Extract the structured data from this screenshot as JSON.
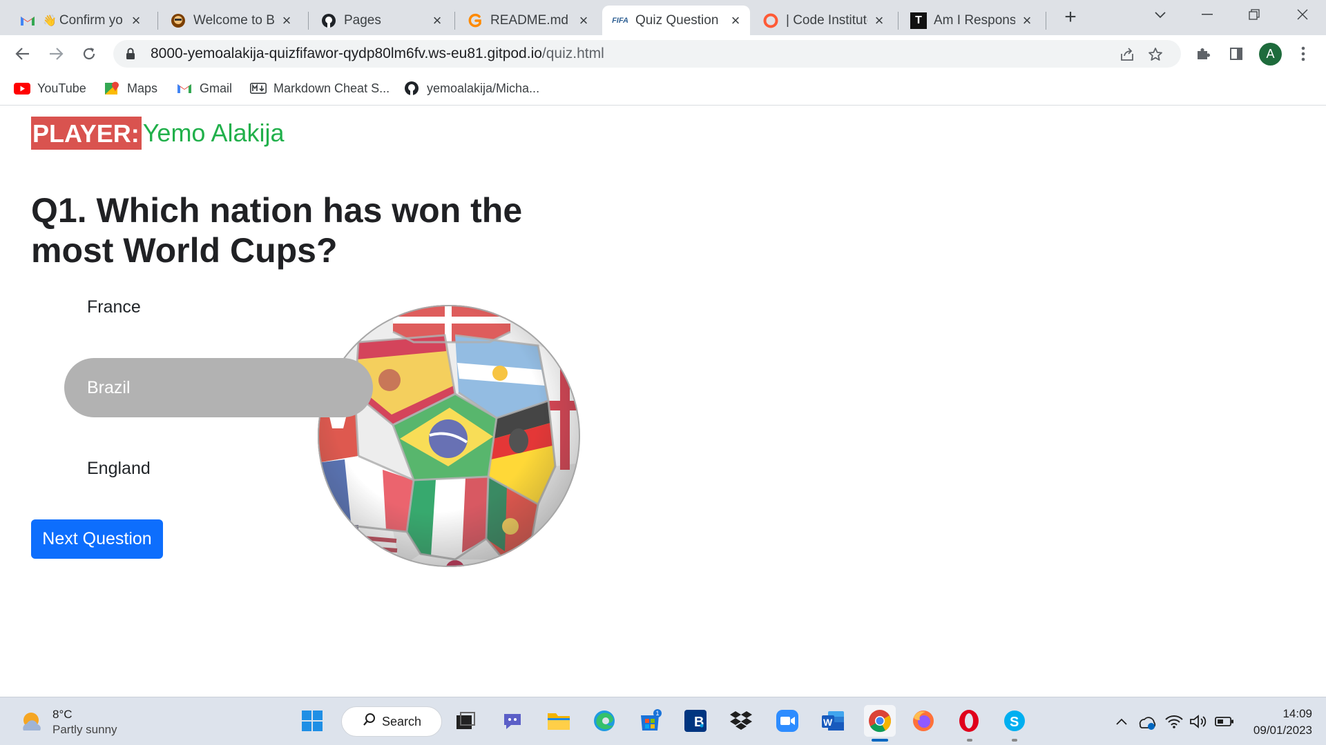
{
  "browser": {
    "tabs": [
      {
        "title": "Confirm yo",
        "favicon": "gmail-icon"
      },
      {
        "title": "Welcome to By",
        "favicon": "bytes-icon"
      },
      {
        "title": "Pages",
        "favicon": "github-icon"
      },
      {
        "title": "README.md - ",
        "favicon": "gitpod-icon"
      },
      {
        "title": "Quiz Question",
        "favicon": "fifa-icon",
        "favicon_text": "FIFA"
      },
      {
        "title": "| Code Institute",
        "favicon": "code-institute-icon"
      },
      {
        "title": "Am I Responsiv",
        "favicon": "amiresponsive-icon",
        "favicon_text": "T"
      }
    ],
    "active_tab": 4,
    "url_host": "8000-yemoalakija-quizfifawor-qydp80lm6fv.ws-eu81.gitpod.io",
    "url_path": "/quiz.html",
    "profile_initial": "A",
    "bookmarks": [
      {
        "label": "YouTube",
        "icon": "youtube-icon"
      },
      {
        "label": "Maps",
        "icon": "maps-icon"
      },
      {
        "label": "Gmail",
        "icon": "gmail-icon"
      },
      {
        "label": "Markdown Cheat S...",
        "icon": "markdown-icon"
      },
      {
        "label": "yemoalakija/Micha...",
        "icon": "github-icon"
      }
    ]
  },
  "quiz": {
    "player_label": "PLAYER:",
    "player_name": "Yemo Alakija",
    "question": "Q1. Which nation has won the most World Cups?",
    "answers": [
      {
        "label": "France",
        "selected": false
      },
      {
        "label": "Brazil",
        "selected": true
      },
      {
        "label": "England",
        "selected": false
      }
    ],
    "next_label": "Next Question"
  },
  "taskbar": {
    "weather_temp": "8°C",
    "weather_condition": "Partly sunny",
    "search_label": "Search",
    "store_badge": "1",
    "time": "14:09",
    "date": "09/01/2023"
  },
  "colors": {
    "player_label_bg": "#d9534f",
    "player_name": "#21b04b",
    "selected_answer_bg": "#b2b2b2",
    "next_button": "#0d6efd"
  }
}
